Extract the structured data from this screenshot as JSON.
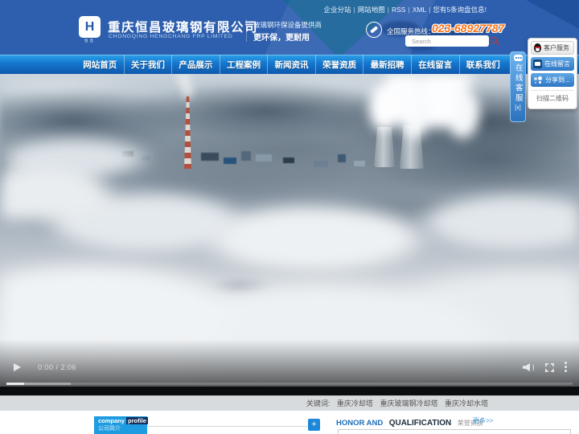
{
  "colors": {
    "header_blue": "#2d5fae",
    "nav_blue_top": "#2ba2ea",
    "nav_blue_bottom": "#0d59ad",
    "accent_bright_blue": "#1e9ce2",
    "hotline_orange": "#ff7417",
    "widget_blue": "#2f77c4"
  },
  "topbar": {
    "separator": "|",
    "links": [
      "企业分站",
      "网站地图",
      "RSS",
      "XML",
      "您有5条询盘信息!"
    ]
  },
  "header": {
    "logo_letter": "H",
    "logo_caption": "恒昌",
    "company_name": "重庆恒昌玻璃钢有限公司",
    "company_name_en": "CHONGQING HENGCHANG FRP LIMITED",
    "slogan_line1": "玻璃钢环保设备提供商",
    "slogan_line2": "更环保，更耐用",
    "hotline_label": "全国服务热线：",
    "hotline_number": "023-68927787",
    "search_placeholder": "Search"
  },
  "nav": {
    "items": [
      "网站首页",
      "关于我们",
      "产品展示",
      "工程案例",
      "新闻资讯",
      "荣誉资质",
      "最新招聘",
      "在线留言",
      "联系我们"
    ]
  },
  "video": {
    "time": "0:00 / 2:06"
  },
  "keywords": {
    "label": "关键词:",
    "items": [
      "重庆冷却塔",
      "重庆玻璃钢冷却塔",
      "重庆冷却水塔"
    ]
  },
  "sections": {
    "company": {
      "title_en_1": "company",
      "title_en_2": "profile",
      "title_cn": "公司简介",
      "expand": "+"
    },
    "honor": {
      "title_en_1": "HONOR AND",
      "title_en_2": "QUALIFICATION",
      "title_cn": "荣誉资质",
      "more": "更多>>"
    }
  },
  "service_widget": {
    "tab_label": "在线客服",
    "tab_close": "[x]",
    "qq_label": "客户服务",
    "message_label": "在线留言",
    "share_label": "分享到...",
    "qr_label": "扫描二维码"
  }
}
